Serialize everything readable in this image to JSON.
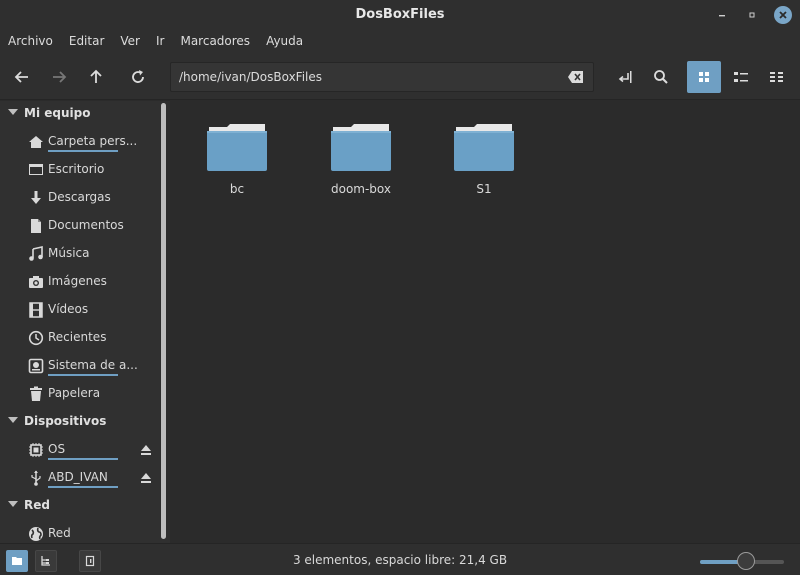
{
  "window": {
    "title": "DosBoxFiles"
  },
  "menu": [
    "Archivo",
    "Editar",
    "Ver",
    "Ir",
    "Marcadores",
    "Ayuda"
  ],
  "location": {
    "path": "/home/ivan/DosBoxFiles"
  },
  "view_mode": "icons",
  "sidebar": {
    "sections": [
      {
        "title": "Mi equipo",
        "items": [
          {
            "label": "Carpeta pers...",
            "icon": "home-icon",
            "usage": 0.5
          },
          {
            "label": "Escritorio",
            "icon": "desktop-icon"
          },
          {
            "label": "Descargas",
            "icon": "download-icon"
          },
          {
            "label": "Documentos",
            "icon": "document-icon"
          },
          {
            "label": "Música",
            "icon": "music-icon"
          },
          {
            "label": "Imágenes",
            "icon": "camera-icon"
          },
          {
            "label": "Vídeos",
            "icon": "film-icon"
          },
          {
            "label": "Recientes",
            "icon": "clock-icon"
          },
          {
            "label": "Sistema de a...",
            "icon": "drive-icon",
            "usage": 0.3
          },
          {
            "label": "Papelera",
            "icon": "trash-icon"
          }
        ]
      },
      {
        "title": "Dispositivos",
        "items": [
          {
            "label": "OS",
            "icon": "chip-icon",
            "usage": 0.3,
            "ejectable": true
          },
          {
            "label": "ABD_IVAN",
            "icon": "usb-icon",
            "usage": 0.2,
            "ejectable": true
          }
        ]
      },
      {
        "title": "Red",
        "items": [
          {
            "label": "Red",
            "icon": "globe-icon"
          }
        ]
      }
    ]
  },
  "folders": [
    "bc",
    "doom-box",
    "S1"
  ],
  "status": {
    "text": "3 elementos, espacio libre: 21,4 GB"
  },
  "zoom": {
    "level": 0.55
  },
  "colors": {
    "accent": "#6f9fc3",
    "folder": "#6aa0c6",
    "background": "#2b2b2b"
  }
}
